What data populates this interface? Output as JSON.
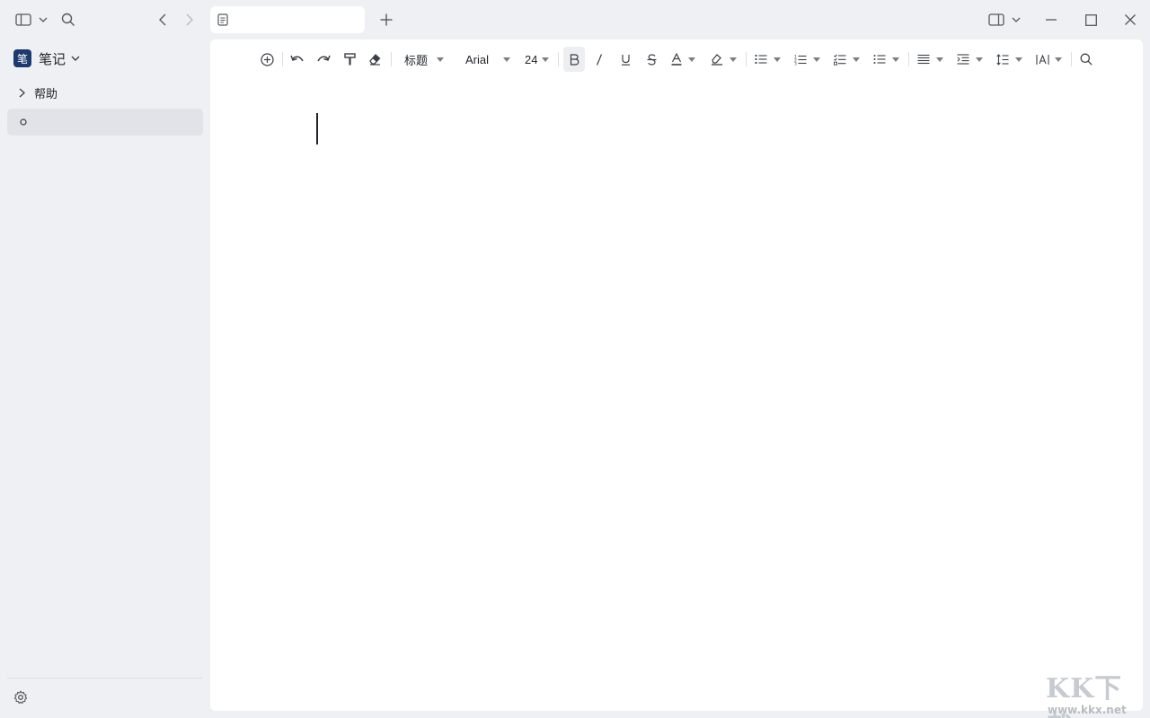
{
  "titlebar": {
    "tab": {
      "title": "",
      "icon": "document-icon"
    }
  },
  "sidebar": {
    "notebook": {
      "badge": "笔",
      "name": "笔记"
    },
    "tree": [
      {
        "label": "帮助",
        "icon": "chevron-right-icon"
      },
      {
        "label": "",
        "icon": "circle-icon",
        "active": true
      }
    ]
  },
  "toolbar": {
    "heading_select": "标题",
    "font_select": "Arial",
    "size_select": "24",
    "bold_active": true
  },
  "editor": {
    "content": ""
  },
  "watermark": {
    "logo": "KK下载",
    "url": "www.kkx.net"
  }
}
